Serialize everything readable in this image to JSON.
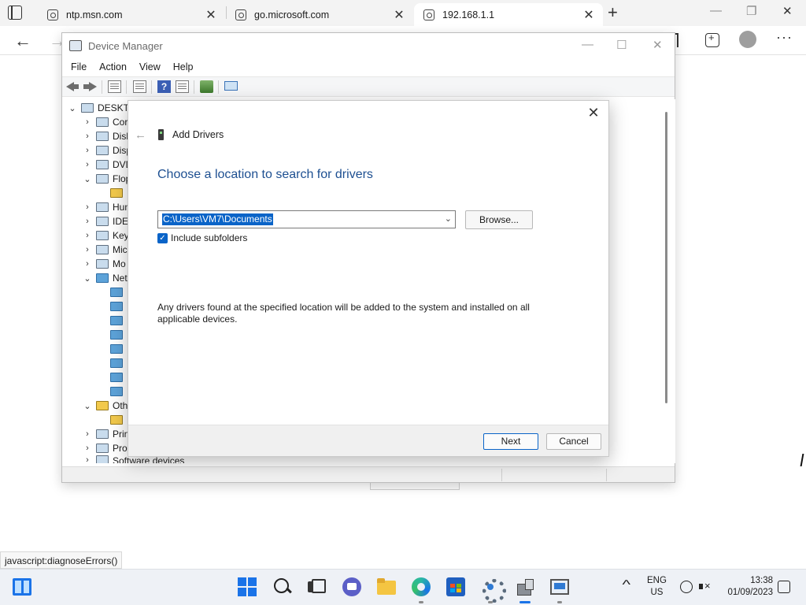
{
  "browser": {
    "tabs": [
      {
        "title": "ntp.msn.com",
        "close": "✕"
      },
      {
        "title": "go.microsoft.com",
        "close": "✕"
      },
      {
        "title": "192.168.1.1",
        "close": "✕"
      }
    ],
    "new_tab": "+",
    "window_controls": {
      "minimize": "—",
      "restore": "❐",
      "close": "✕"
    },
    "nav": {
      "back": "←",
      "forward": "→",
      "more": "···"
    },
    "status_url": "javascript:diagnoseErrors()"
  },
  "device_manager": {
    "title": "Device Manager",
    "window_controls": {
      "minimize": "—",
      "maximize": "☐",
      "close": "✕"
    },
    "menu": [
      "File",
      "Action",
      "View",
      "Help"
    ],
    "tree": [
      {
        "label": "DESKTC",
        "chevron": "⌄",
        "icon": "computer-icon"
      },
      {
        "label": "Cor",
        "chevron": "›",
        "icon": "computer-icon"
      },
      {
        "label": "Disk",
        "chevron": "›",
        "icon": "disk-drive-icon"
      },
      {
        "label": "Disp",
        "chevron": "›",
        "icon": "display-adapter-icon"
      },
      {
        "label": "DVD",
        "chevron": "›",
        "icon": "dvd-drive-icon"
      },
      {
        "label": "Flop",
        "chevron": "⌄",
        "icon": "floppy-icon"
      },
      {
        "label": "",
        "chevron": "",
        "icon": "warning-device-icon"
      },
      {
        "label": "Hun",
        "chevron": "›",
        "icon": "hid-icon"
      },
      {
        "label": "IDE",
        "chevron": "›",
        "icon": "ide-controller-icon"
      },
      {
        "label": "Key",
        "chevron": "›",
        "icon": "keyboard-icon"
      },
      {
        "label": "Mic",
        "chevron": "›",
        "icon": "mouse-icon"
      },
      {
        "label": "Mo",
        "chevron": "›",
        "icon": "monitor-icon"
      },
      {
        "label": "Net",
        "chevron": "⌄",
        "icon": "network-adapter-icon"
      },
      {
        "label": "",
        "chevron": "",
        "icon": "network-adapter-icon"
      },
      {
        "label": "",
        "chevron": "",
        "icon": "network-adapter-icon"
      },
      {
        "label": "",
        "chevron": "",
        "icon": "network-adapter-icon"
      },
      {
        "label": "",
        "chevron": "",
        "icon": "network-adapter-icon"
      },
      {
        "label": "",
        "chevron": "",
        "icon": "network-adapter-icon"
      },
      {
        "label": "",
        "chevron": "",
        "icon": "network-adapter-icon"
      },
      {
        "label": "",
        "chevron": "",
        "icon": "network-adapter-icon"
      },
      {
        "label": "",
        "chevron": "",
        "icon": "network-adapter-icon"
      },
      {
        "label": "Oth",
        "chevron": "⌄",
        "icon": "other-devices-icon"
      },
      {
        "label": "",
        "chevron": "",
        "icon": "warning-device-icon"
      },
      {
        "label": "Prin",
        "chevron": "›",
        "icon": "printer-icon"
      },
      {
        "label": "Pro",
        "chevron": "›",
        "icon": "processor-icon"
      },
      {
        "label": "Software devices",
        "chevron": "›",
        "icon": "software-device-icon"
      }
    ]
  },
  "dialog": {
    "close": "✕",
    "back": "←",
    "header": "Add Drivers",
    "heading": "Choose a location to search for drivers",
    "path_value": "C:\\Users\\VM7\\Documents",
    "path_dropdown": "⌄",
    "browse_label": "Browse...",
    "include_subfolders_label": "Include subfolders",
    "include_subfolders_checked": true,
    "check_mark": "✓",
    "info_line1": "Any drivers found at the specified location will be added to the system and installed on all",
    "info_line2": "applicable devices.",
    "next_label": "Next",
    "cancel_label": "Cancel"
  },
  "taskbar": {
    "apps": [
      "start",
      "search",
      "task-view",
      "chat",
      "file-explorer",
      "edge",
      "store",
      "settings",
      "device-manager",
      "remote-desktop"
    ],
    "tray_chevron": "^",
    "lang_line1": "ENG",
    "lang_line2": "US",
    "time": "13:38",
    "date": "01/09/2023"
  },
  "colors": {
    "accent": "#0a64c8",
    "heading": "#1d4f91",
    "taskbar_bg": "#eef1f6"
  }
}
